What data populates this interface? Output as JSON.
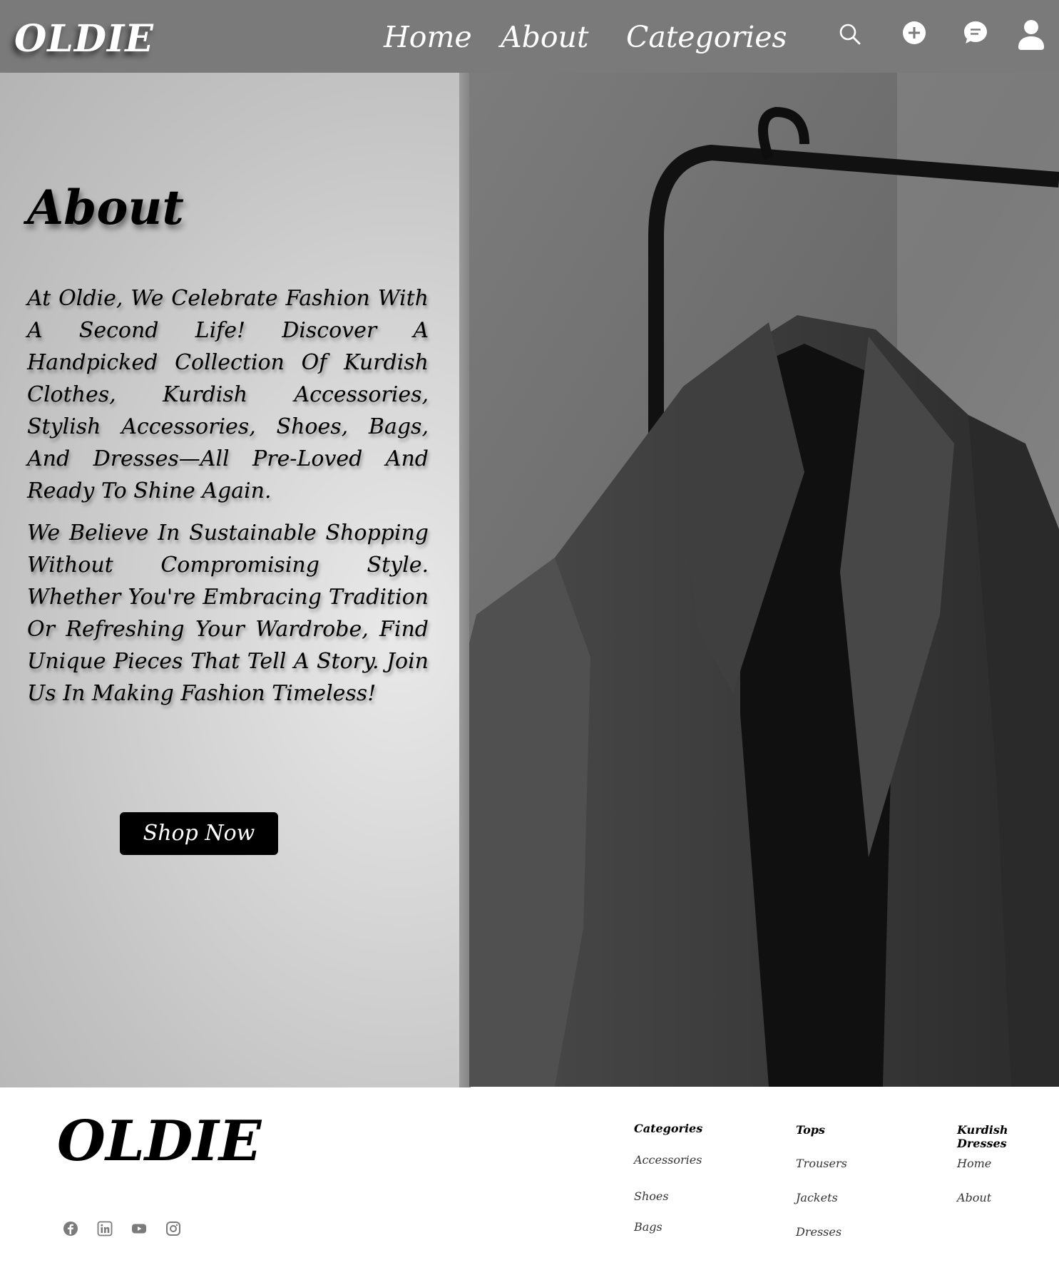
{
  "header": {
    "logo": "OLDIE",
    "nav": {
      "home": "Home",
      "about": "About",
      "categories": "Categories"
    },
    "icons": [
      "search-icon",
      "plus-circle-icon",
      "chat-icon",
      "user-icon"
    ]
  },
  "hero": {
    "title": "About",
    "paragraph1": "At Oldie, We Celebrate Fashion With A Second Life! Discover A Handpicked Collection Of Kurdish Clothes, Kurdish Accessories, Stylish Accessories, Shoes, Bags, And Dresses—All Pre-Loved And Ready To Shine Again.",
    "paragraph2": "We Believe In Sustainable Shopping Without Compromising Style. Whether You're Embracing Tradition Or Refreshing Your Wardrobe, Find Unique Pieces That Tell A Story. Join Us In Making Fashion Timeless!",
    "cta": "Shop Now"
  },
  "footer": {
    "logo": "OLDIE",
    "social_icons": [
      "facebook-icon",
      "linkedin-icon",
      "youtube-icon",
      "instagram-icon"
    ],
    "col1": {
      "head": "Categories",
      "links": [
        "Accessories",
        "Shoes",
        "Bags"
      ]
    },
    "col2": {
      "head": "Tops",
      "links": [
        "Trousers",
        "Jackets",
        "Dresses"
      ]
    },
    "col3": {
      "head": "Kurdish Dresses",
      "links": [
        "Home",
        "About"
      ]
    }
  },
  "colors": {
    "header_bg": "#7a7a7a",
    "button_bg": "#000000",
    "text_light": "#ffffff"
  }
}
